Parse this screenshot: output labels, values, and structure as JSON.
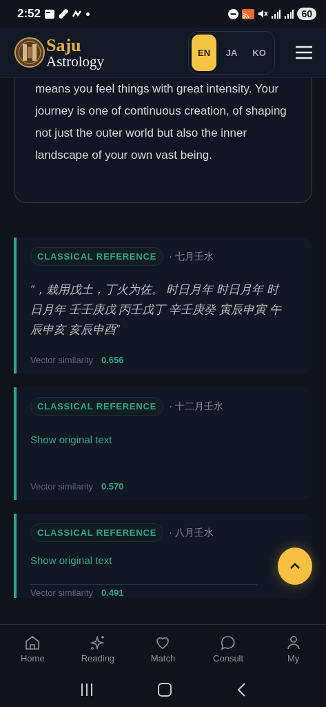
{
  "status_bar": {
    "time": "2:52",
    "battery": "60"
  },
  "header": {
    "logo_top": "Saju",
    "logo_bottom": "Astrology",
    "languages": [
      {
        "label": "EN",
        "selected": true
      },
      {
        "label": "JA",
        "selected": false
      },
      {
        "label": "KO",
        "selected": false
      }
    ]
  },
  "reading": {
    "paragraph": "means you feel things with great intensity. Your journey is one of continuous creation, of shaping not just the outer world but also the inner landscape of your own vast being."
  },
  "references": [
    {
      "kind": "quote",
      "tag": "CLASSICAL REFERENCE",
      "source": "· 七月壬水",
      "text": "“，栽用戊土，丁火为佐。 时日月年 时日月年 时日月年 壬壬庚戊 丙壬戊丁 辛壬庚癸 寅辰申寅 午辰申亥 亥辰申酉”",
      "similarity_label": "Vector similarity",
      "similarity": "0.656"
    },
    {
      "kind": "collapsed",
      "tag": "CLASSICAL REFERENCE",
      "source": "· 十二月壬水",
      "text": "Show original text",
      "similarity_label": "Vector similarity",
      "similarity": "0.570"
    },
    {
      "kind": "collapsed",
      "tag": "CLASSICAL REFERENCE",
      "source": "· 八月壬水",
      "text": "Show original text",
      "similarity_label": "Vector similarity",
      "similarity": "0.491"
    }
  ],
  "nav": [
    {
      "label": "Home"
    },
    {
      "label": "Reading"
    },
    {
      "label": "Match"
    },
    {
      "label": "Consult"
    },
    {
      "label": "My"
    }
  ]
}
